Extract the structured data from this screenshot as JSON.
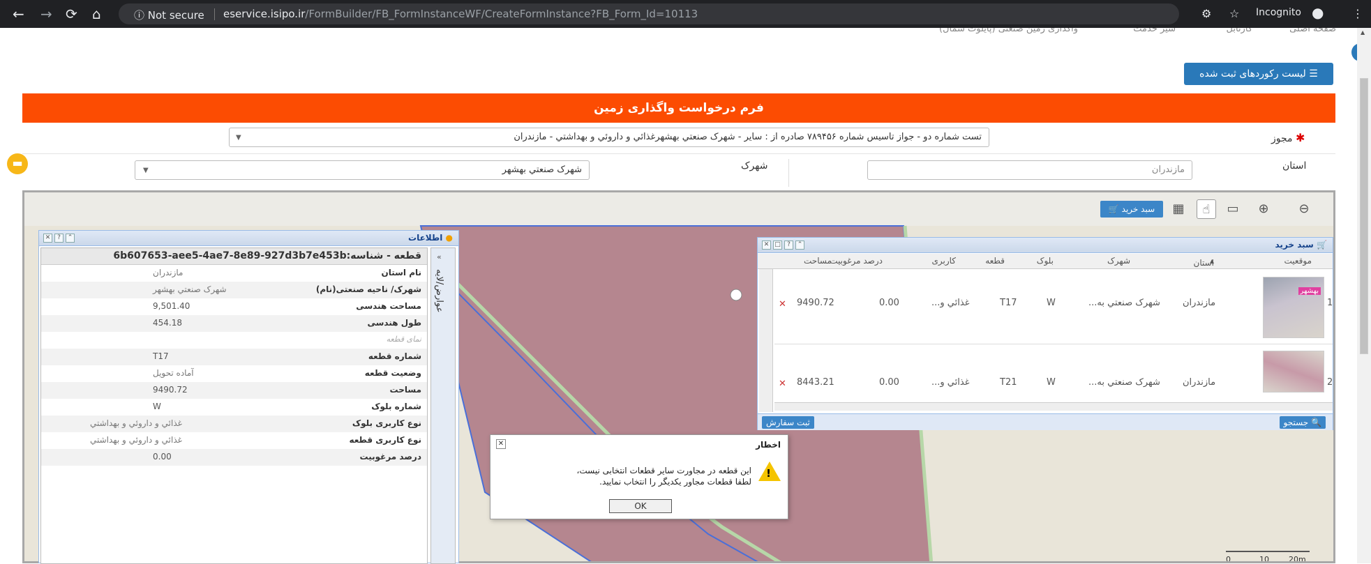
{
  "browser": {
    "security": "Not secure",
    "url_host": "eservice.isipo.ir",
    "url_path": "/FormBuilder/FB_FormInstanceWF/CreateFormInstance?FB_Form_Id=10113",
    "incognito_label": "Incognito"
  },
  "topmenu": {
    "items": [
      "صفحه اصلی",
      "کارتابل",
      "سیر خدمت",
      "واگذاری زمین صنعتی (پایلوت شمال)"
    ]
  },
  "records_button": "لیست رکوردهای ثبت شده",
  "form": {
    "title": "فرم درخواست واگذاری زمین",
    "license_label": "مجوز",
    "license_value": "تست شماره دو - جواز تاسیس شماره ۷۸۹۴۵۶ صادره از : سایر - شهرک صنعتي بهشهرغذائي و داروئي و بهداشتي - مازندران",
    "province_label": "استان",
    "province_value": "مازندران",
    "town_label": "شهرک",
    "town_value": "شهرک صنعتي بهشهر"
  },
  "map": {
    "cart_button": "سبد خرید",
    "scale_labels": [
      "0",
      "10",
      "20m"
    ],
    "tools": [
      "zoom-out-icon",
      "zoom-in-icon",
      "ruler-icon",
      "hand-icon",
      "grid-icon",
      "cart-icon"
    ]
  },
  "info_panel": {
    "title": "اطلاعات",
    "side_tab": "عوارض/لایه",
    "header": "قطعه - شناسه:6b607653-aee5-4ae7-8e89-927d3b7e453b",
    "rows": [
      {
        "key": "نام استان",
        "value": "مازندران"
      },
      {
        "key": "شهرک/ ناحیه صنعتی(نام)",
        "value": "شهرک صنعتي بهشهر"
      },
      {
        "key": "مساحت هندسی",
        "value": "9,501.40"
      },
      {
        "key": "طول هندسی",
        "value": "454.18"
      },
      {
        "key": "نمای قطعه",
        "value": ""
      },
      {
        "key": "شماره قطعه",
        "value": "T17"
      },
      {
        "key": "وضعیت قطعه",
        "value": "آماده تحویل"
      },
      {
        "key": "مساحت",
        "value": "9490.72"
      },
      {
        "key": "شماره بلوک",
        "value": "W"
      },
      {
        "key": "نوع کاربری بلوک",
        "value": "غذائي و داروئي و بهداشتي"
      },
      {
        "key": "نوع کاربری قطعه",
        "value": "غذائي و داروئي و بهداشتي"
      },
      {
        "key": "درصد مرغوبیت",
        "value": "0.00"
      }
    ]
  },
  "cart_panel": {
    "title": "سبد خرید",
    "columns": [
      "موقعیت",
      "استان",
      "شهرک",
      "بلوک",
      "قطعه",
      "کاربری",
      "درصد مرغوبیت",
      "مساحت"
    ],
    "rows": [
      {
        "num": "1",
        "province": "مازندران",
        "town": "شهرک صنعتي به...",
        "block": "W",
        "plot": "T17",
        "usage": "غذائي و...",
        "quality": "0.00",
        "area": "9490.72"
      },
      {
        "num": "2",
        "province": "مازندران",
        "town": "شهرک صنعتي به...",
        "block": "W",
        "plot": "T21",
        "usage": "غذائي و...",
        "quality": "0.00",
        "area": "8443.21"
      }
    ],
    "thumb_label": "بهشهر",
    "search_button": "جستجو",
    "submit_button": "ثبت سفارش"
  },
  "dialog": {
    "title": "اخطار",
    "line1": "این قطعه در مجاورت سایر قطعات انتخابی نیست،",
    "line2": "لطفا قطعات مجاور یکدیگر را انتخاب نمایید.",
    "ok": "OK"
  }
}
